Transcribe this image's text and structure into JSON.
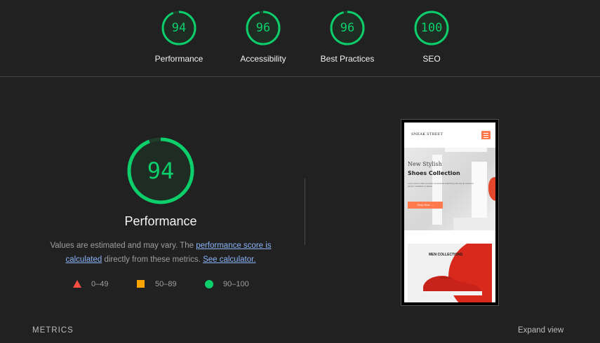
{
  "top_gauges": [
    {
      "score": "94",
      "label": "Performance",
      "value": 94
    },
    {
      "score": "96",
      "label": "Accessibility",
      "value": 96
    },
    {
      "score": "96",
      "label": "Best Practices",
      "value": 96
    },
    {
      "score": "100",
      "label": "SEO",
      "value": 100
    }
  ],
  "performance": {
    "score": "94",
    "value": 94,
    "title": "Performance",
    "desc_part1": "Values are estimated and may vary. The ",
    "link_score": "performance score is calculated",
    "desc_part2": " directly from these metrics. ",
    "link_calc": "See calculator."
  },
  "legend": {
    "fail": "0–49",
    "average": "50–89",
    "pass": "90–100"
  },
  "screenshot": {
    "logo": "SNEAK STREET",
    "hero_title_line1": "New Stylish",
    "hero_title_line2": "Shoes Collection",
    "hero_body": "Lorem ipsum dolor sit amet consectetur adipiscing elit sed do eiusmod tempor incididunt ut labore",
    "hero_button": "Shop Now →",
    "collections_title": "MEN COLLECTIONS"
  },
  "footer": {
    "metrics_label": "METRICS",
    "expand_label": "Expand view"
  },
  "colors": {
    "pass": "#0cce6b",
    "average": "#ffa400",
    "fail": "#ff4e42",
    "background": "#212121",
    "link": "#8ab4f8"
  }
}
